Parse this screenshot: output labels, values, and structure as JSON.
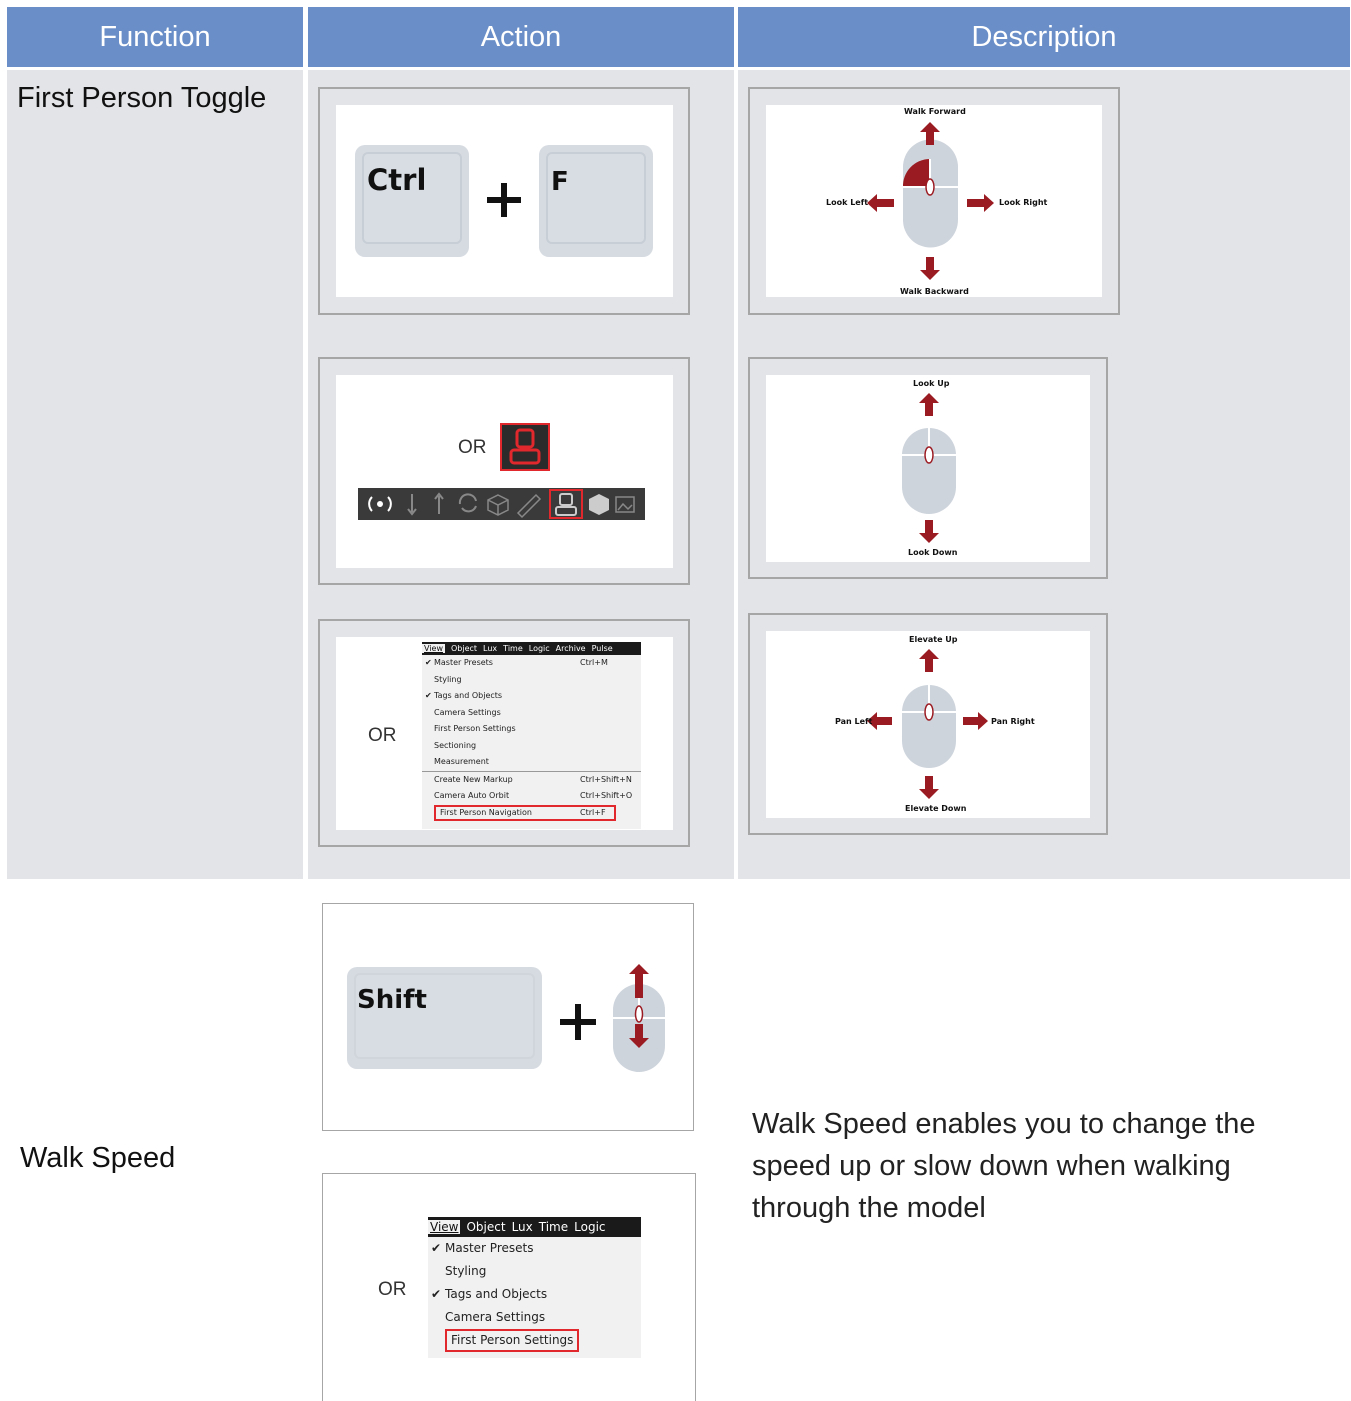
{
  "headers": {
    "function": "Function",
    "action": "Action",
    "description": "Description"
  },
  "colors": {
    "header_bg": "#6a8fc8",
    "cell_bg": "#e2e4e7",
    "accent_red": "#9b1b22",
    "mouse_gray": "#ced4dc"
  },
  "row1": {
    "function": "First Person Toggle",
    "keys": {
      "ctrl": "Ctrl",
      "f": "F"
    },
    "or1": "OR",
    "or2": "OR",
    "toolbar_icons": [
      "broadcast-icon",
      "arrow-down-icon",
      "arrow-up-icon",
      "rotate-icon",
      "cube-outline-icon",
      "ruler-icon",
      "person-icon",
      "cube-solid-icon",
      "image-icon"
    ],
    "menu": {
      "bar": [
        "View",
        "Object",
        "Lux",
        "Time",
        "Logic",
        "Archive",
        "Pulse"
      ],
      "items": [
        {
          "label": "Master Presets",
          "shortcut": "Ctrl+M",
          "checked": true
        },
        {
          "label": "Styling",
          "shortcut": "",
          "checked": false
        },
        {
          "label": "Tags and Objects",
          "shortcut": "",
          "checked": true
        },
        {
          "label": "Camera Settings",
          "shortcut": "",
          "checked": false
        },
        {
          "label": "First Person Settings",
          "shortcut": "",
          "checked": false
        },
        {
          "label": "Sectioning",
          "shortcut": "",
          "checked": false
        },
        {
          "label": "Measurement",
          "shortcut": "",
          "checked": false
        },
        {
          "label": "Create New Markup",
          "shortcut": "Ctrl+Shift+N",
          "checked": false
        },
        {
          "label": "Camera Auto Orbit",
          "shortcut": "Ctrl+Shift+O",
          "checked": false
        },
        {
          "label": "First Person Navigation",
          "shortcut": "Ctrl+F",
          "checked": false,
          "highlight": true
        }
      ]
    },
    "diagrams": {
      "d1": {
        "up": "Walk Forward",
        "down": "Walk Backward",
        "left": "Look Left",
        "right": "Look Right"
      },
      "d2": {
        "up": "Look Up",
        "down": "Look Down"
      },
      "d3": {
        "up": "Elevate Up",
        "down": "Elevate Down",
        "left": "Pan Left",
        "right": "Pan Right"
      }
    }
  },
  "row2": {
    "function": "Walk Speed",
    "keys": {
      "shift": "Shift"
    },
    "or": "OR",
    "menu": {
      "bar": [
        "View",
        "Object",
        "Lux",
        "Time",
        "Logic"
      ],
      "items": [
        {
          "label": "Master Presets",
          "checked": true
        },
        {
          "label": "Styling",
          "checked": false
        },
        {
          "label": "Tags and Objects",
          "checked": true
        },
        {
          "label": "Camera Settings",
          "checked": false
        },
        {
          "label": "First Person Settings",
          "checked": false,
          "highlight": true
        }
      ]
    },
    "description": "Walk Speed enables you to change the speed up or slow down when walking through the model"
  }
}
